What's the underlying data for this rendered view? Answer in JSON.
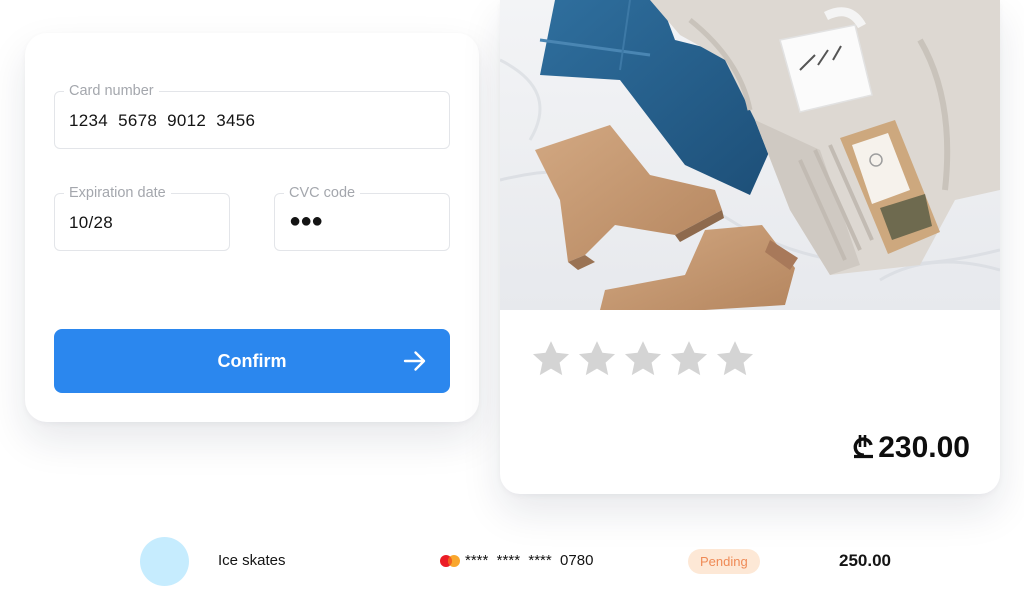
{
  "payment_form": {
    "card_number": {
      "label": "Card number",
      "value": "1234  5678  9012  3456"
    },
    "expiration_date": {
      "label": "Expiration date",
      "value": "10/28"
    },
    "cvc_code": {
      "label": "CVC code",
      "value": "●●●"
    },
    "confirm_label": "Confirm",
    "colors": {
      "button": "#2b87ee",
      "field_border": "#e3e5e9",
      "label": "#a4a7ad"
    },
    "icons": {
      "confirm": "arrow-right-icon"
    }
  },
  "product": {
    "rating": 0,
    "rating_max": 5,
    "price": "230.00",
    "currency_icon": "lari-currency-icon",
    "photo_icon": "product-photo-icon",
    "colors": {
      "star_empty": "#d4d4d4"
    }
  },
  "transaction": {
    "item": "Ice skates",
    "card_brand_icon": "mastercard-icon",
    "masked_card": "****  ****  ****  0780",
    "status": "Pending",
    "amount": "250.00",
    "colors": {
      "avatar": "#c6ecfe",
      "status_bg": "#fde8d6",
      "status_text": "#ef8a56"
    }
  }
}
